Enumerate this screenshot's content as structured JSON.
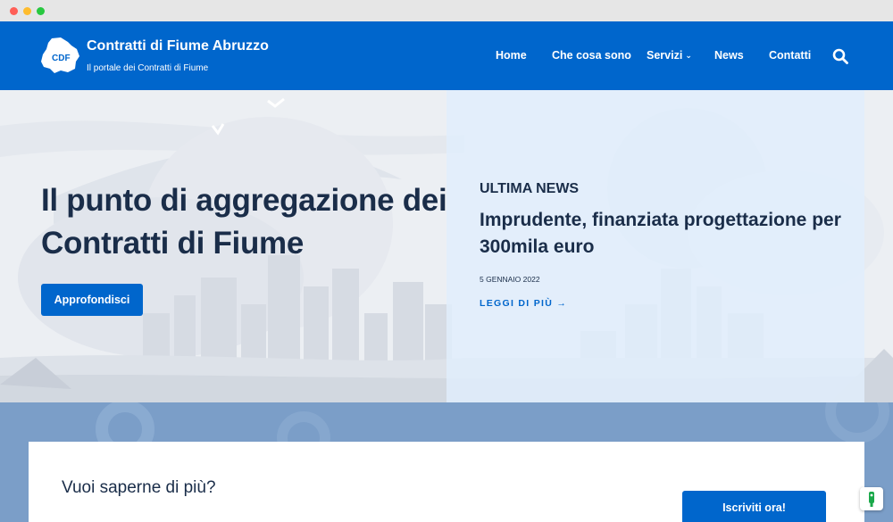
{
  "header": {
    "site_title": "Contratti di Fiume Abruzzo",
    "tagline": "Il portale dei Contratti di Fiume",
    "logo_text": "CDF",
    "nav": [
      "Home",
      "Che cosa sono",
      "Servizi",
      "News",
      "Contatti"
    ]
  },
  "hero": {
    "title": "Il punto di aggregazione dei Contratti di Fiume",
    "button_label": "Approfondisci"
  },
  "news": {
    "kicker": "ULTIMA NEWS",
    "title": "Imprudente, finanziata progettazione per 300mila euro",
    "date": "5 GENNAIO 2022",
    "link_label": "LEGGI DI PIÙ →"
  },
  "cta": {
    "heading": "Vuoi saperne di più?",
    "button_label": "Iscriviti ora!"
  },
  "colors": {
    "brand": "#0066cc",
    "text_dark": "#1a2d49",
    "band": "#7b9ec8"
  },
  "icons": {
    "search": "search-icon",
    "chevron": "chevron-down-icon",
    "logo": "abruzzo-map-logo",
    "floating": "accessibility-icon"
  }
}
